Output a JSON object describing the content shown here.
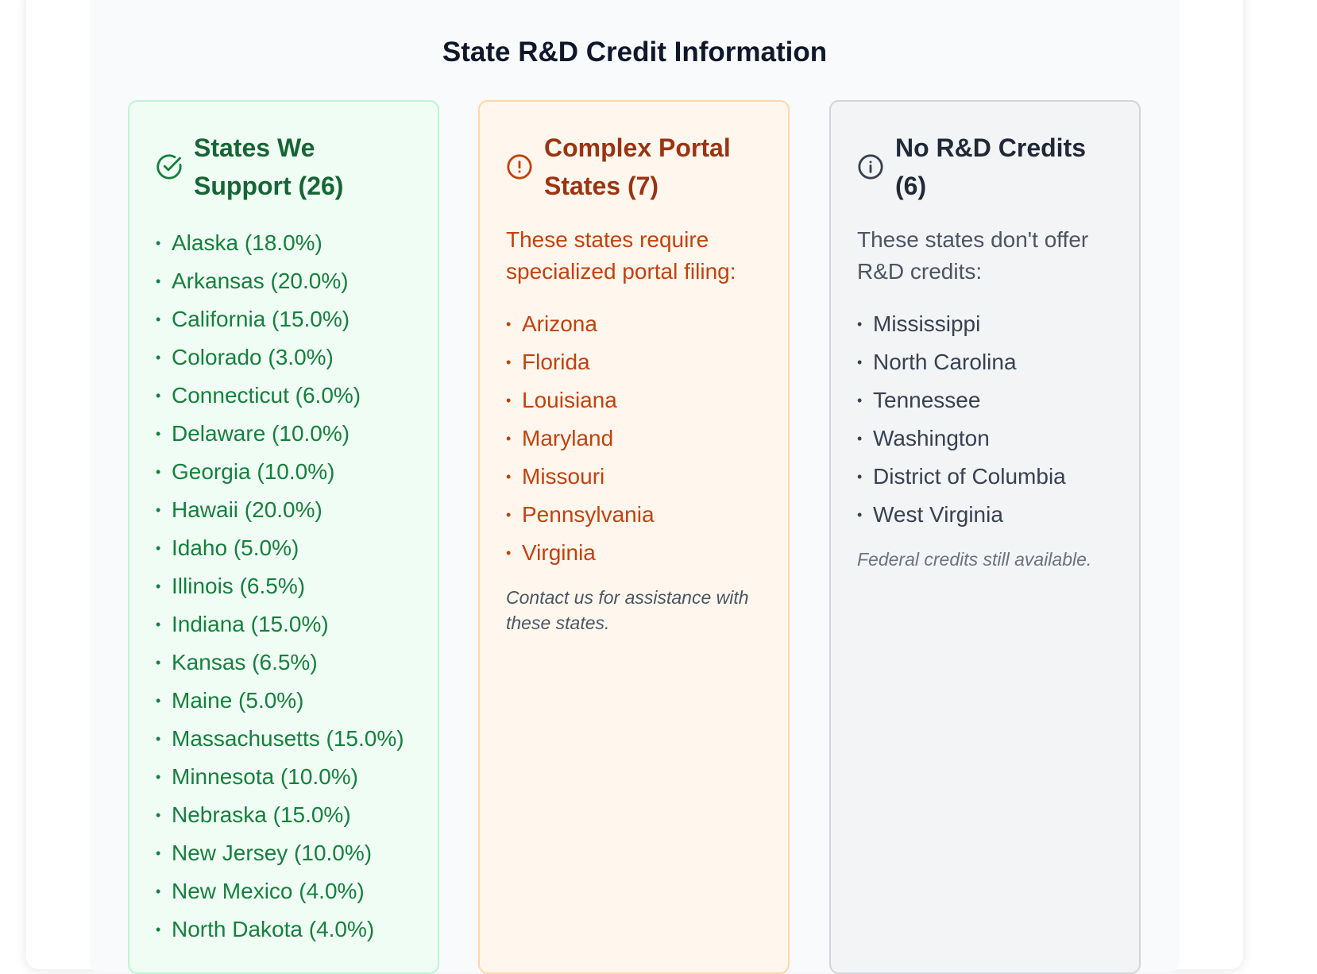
{
  "page": {
    "title": "State R&D Credit Information"
  },
  "columns": {
    "supported": {
      "icon": "check-circle-icon",
      "title": "States We Support (26)",
      "accent": "#15803d",
      "states": [
        "Alaska (18.0%)",
        "Arkansas (20.0%)",
        "California (15.0%)",
        "Colorado (3.0%)",
        "Connecticut (6.0%)",
        "Delaware (10.0%)",
        "Georgia (10.0%)",
        "Hawaii (20.0%)",
        "Idaho (5.0%)",
        "Illinois (6.5%)",
        "Indiana (15.0%)",
        "Kansas (6.5%)",
        "Maine (5.0%)",
        "Massachusetts (15.0%)",
        "Minnesota (10.0%)",
        "Nebraska (15.0%)",
        "New Jersey (10.0%)",
        "New Mexico (4.0%)",
        "North Dakota (4.0%)"
      ]
    },
    "portal": {
      "icon": "alert-circle-icon",
      "title": "Complex Portal States (7)",
      "accent": "#c2410c",
      "description": "These states require specialized portal filing:",
      "states": [
        "Arizona",
        "Florida",
        "Louisiana",
        "Maryland",
        "Missouri",
        "Pennsylvania",
        "Virginia"
      ],
      "note": "Contact us for assistance with these states."
    },
    "none": {
      "icon": "info-circle-icon",
      "title": "No R&D Credits (6)",
      "accent": "#374151",
      "description": "These states don't offer R&D credits:",
      "states": [
        "Mississippi",
        "North Carolina",
        "Tennessee",
        "Washington",
        "District of Columbia",
        "West Virginia"
      ],
      "note": "Federal credits still available."
    }
  }
}
